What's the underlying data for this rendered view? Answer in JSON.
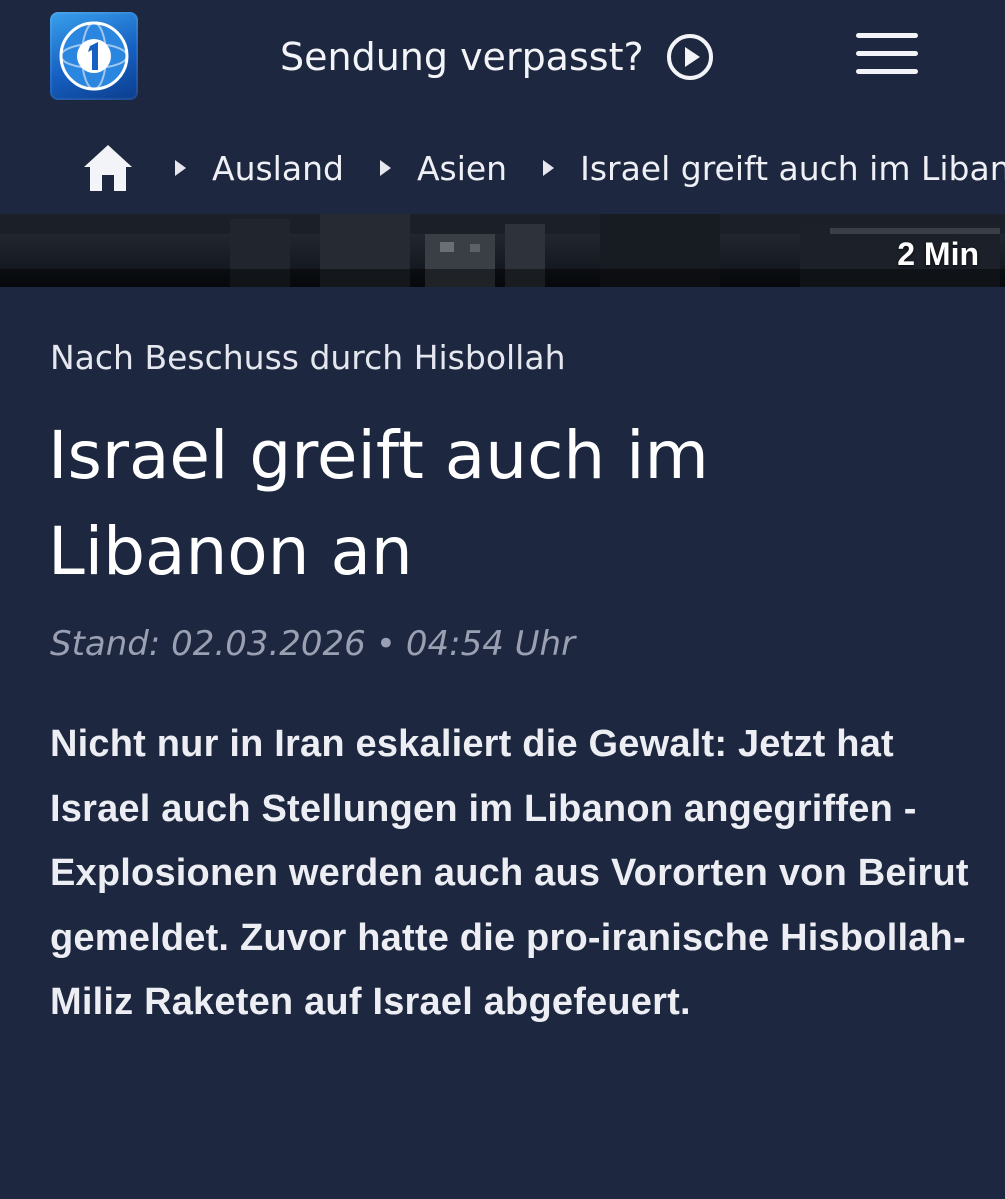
{
  "header": {
    "logo_icon": "tagesschau-globe-logo-icon",
    "missed_label": "Sendung verpasst?",
    "play_icon": "play-circle-icon",
    "menu_icon": "hamburger-menu-icon"
  },
  "breadcrumb": {
    "home_icon": "home-icon",
    "items": [
      "Ausland",
      "Asien",
      "Israel greift auch im Libanon an"
    ]
  },
  "hero": {
    "duration": "2 Min"
  },
  "article": {
    "topline": "Nach Beschuss durch Hisbollah",
    "headline_line1": "Israel greift auch im",
    "headline_line2": "Libanon an",
    "stand_label": "Stand: 02.03.2026",
    "stand_sep": "•",
    "stand_time": "04:54 Uhr",
    "teaser": "Nicht nur in Iran eskaliert die Gewalt: Jetzt hat Israel auch Stellungen im Libanon angegriffen - Explosionen werden auch aus Vororten von Beirut gemeldet. Zuvor hatte die pro-iranische Hisbollah-Miliz Raketen auf Israel abgefeuert."
  },
  "colors": {
    "background": "#1d2740",
    "text": "#ffffff",
    "muted": "#9aa0b2",
    "logo_blue": "#1560c2"
  }
}
